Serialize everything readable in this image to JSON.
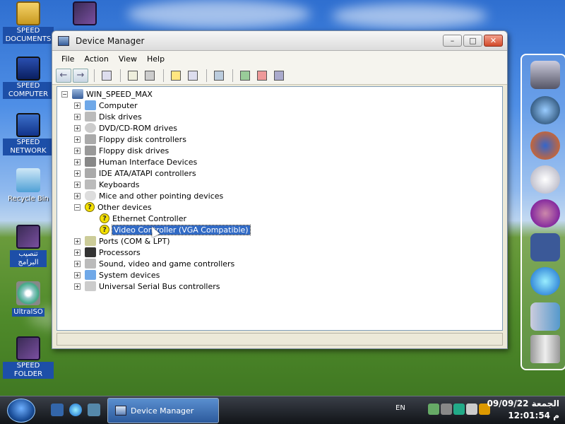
{
  "desktop": {
    "icons": [
      {
        "label": "SPEED DOCUMENTS"
      },
      {
        "label": "SPEED COMPUTER"
      },
      {
        "label": "SPEED NETWORK"
      },
      {
        "label": "Recycle Bin"
      },
      {
        "label": "تنصيب البرامج"
      },
      {
        "label": "UltraISO"
      },
      {
        "label": "SPEED FOLDER"
      }
    ]
  },
  "window": {
    "title": "Device Manager",
    "menu": [
      "File",
      "Action",
      "View",
      "Help"
    ],
    "tree": {
      "root": "WIN_SPEED_MAX",
      "items": [
        "Computer",
        "Disk drives",
        "DVD/CD-ROM drives",
        "Floppy disk controllers",
        "Floppy disk drives",
        "Human Interface Devices",
        "IDE ATA/ATAPI controllers",
        "Keyboards",
        "Mice and other pointing devices",
        "Other devices",
        "Ethernet Controller",
        "Video Controller (VGA Compatible)",
        "Ports (COM & LPT)",
        "Processors",
        "Sound, video and game controllers",
        "System devices",
        "Universal Serial Bus controllers"
      ],
      "selected": "Video Controller (VGA Compatible)"
    }
  },
  "taskbar": {
    "task_label": "Device Manager",
    "lang": "EN",
    "date": "09/09/22 الجمعة",
    "time": "12:01:54 م"
  },
  "colors": {
    "selection": "#316ac5",
    "label_bg": "#1d4fa8"
  }
}
